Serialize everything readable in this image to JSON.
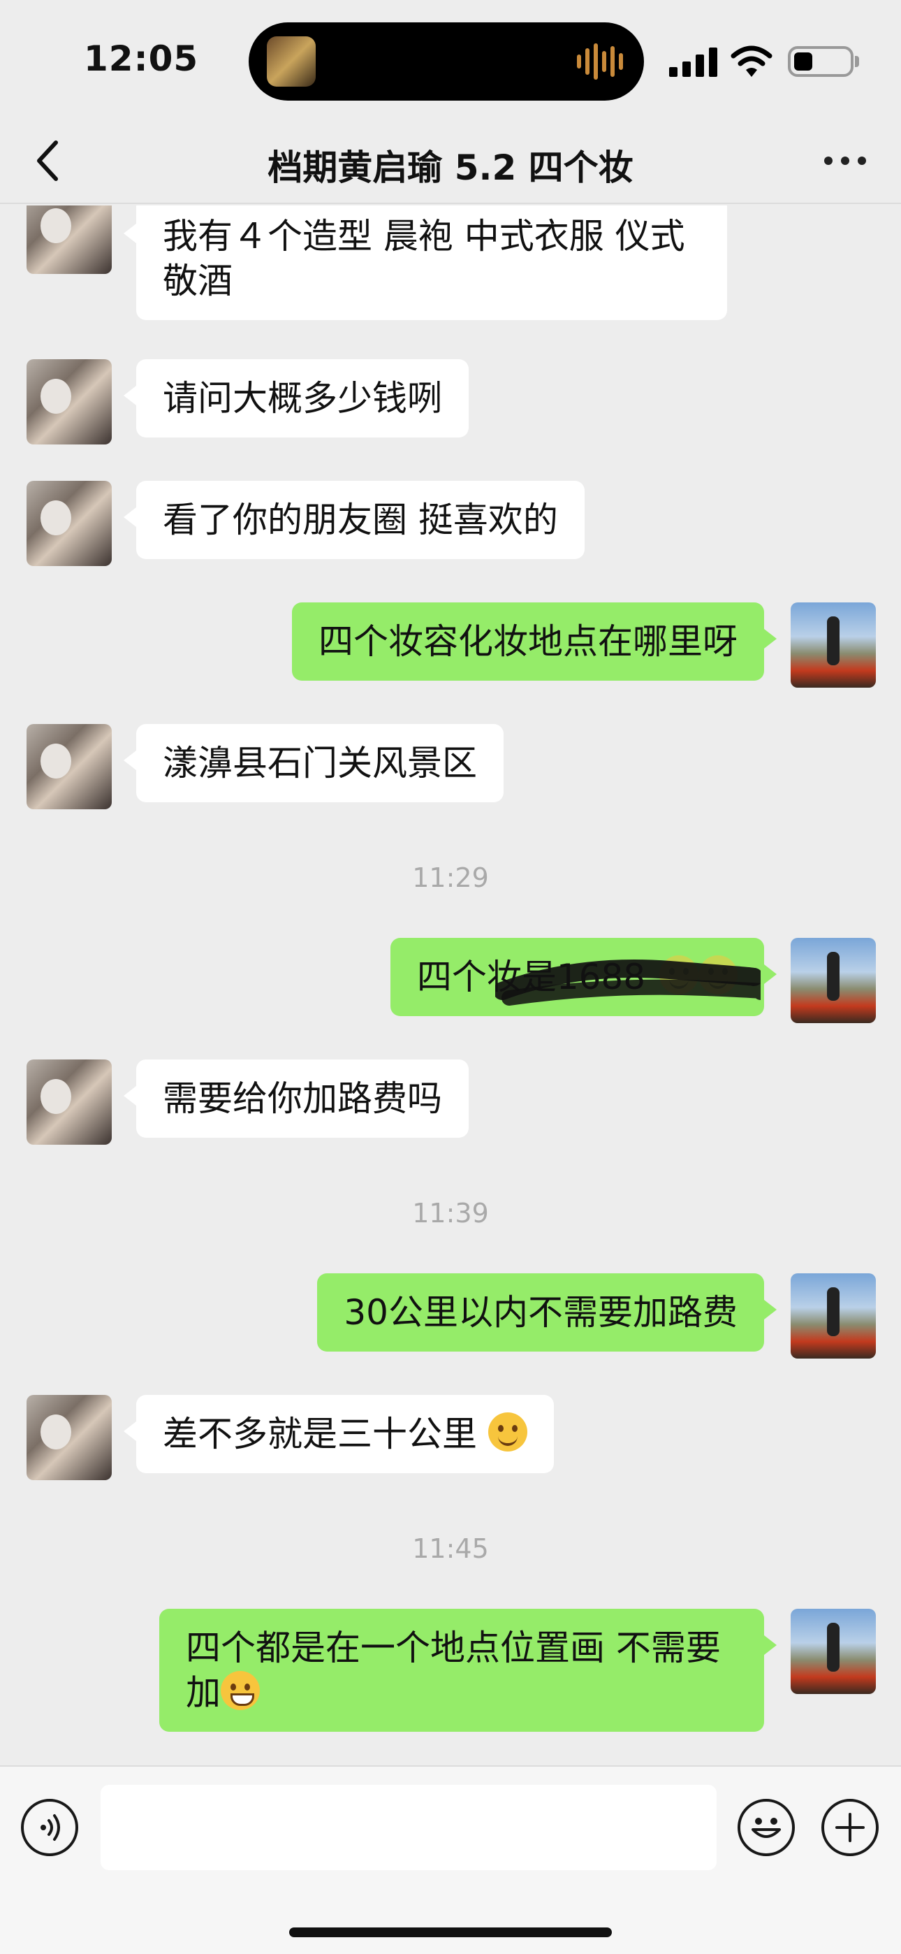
{
  "status_bar": {
    "time": "12:05",
    "battery_level": 0.3,
    "signal_bars": 4
  },
  "nav": {
    "title": "档期黄启瑜 5.2  四个妆",
    "back_icon": "chevron-left-icon",
    "more_icon": "ellipsis-icon"
  },
  "messages": [
    {
      "side": "left",
      "text": "我有４个造型 晨袍 中式衣服 仪式敬酒"
    },
    {
      "side": "left",
      "text": "请问大概多少钱咧"
    },
    {
      "side": "left",
      "text": "看了你的朋友圈 挺喜欢的"
    },
    {
      "side": "right",
      "text": "四个妆容化妆地点在哪里呀"
    },
    {
      "side": "left",
      "text": "漾濞县石门关风景区"
    },
    {
      "time": "11:29"
    },
    {
      "side": "right",
      "text": "四个妆是1688",
      "redacted": true
    },
    {
      "side": "left",
      "text": "需要给你加路费吗"
    },
    {
      "time": "11:39"
    },
    {
      "side": "right",
      "text": "30公里以内不需要加路费"
    },
    {
      "side": "left",
      "text": "差不多就是三十公里",
      "emoji": "smiling-face"
    },
    {
      "time": "11:45"
    },
    {
      "side": "right",
      "text": "四个都是在一个地点位置画 不需要加",
      "emoji": "grinning-face"
    }
  ],
  "input_bar": {
    "voice_icon": "voice-icon",
    "emoji_icon": "emoji-icon",
    "plus_icon": "plus-icon"
  }
}
